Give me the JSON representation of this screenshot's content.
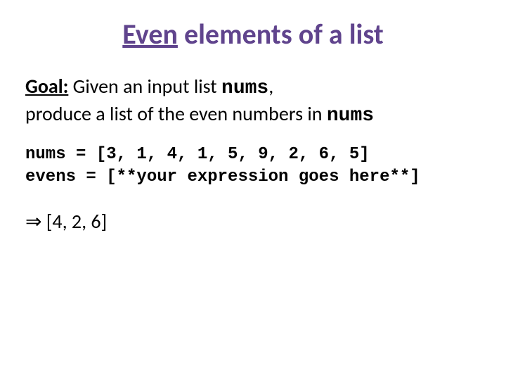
{
  "title": {
    "underlined": "Even",
    "rest": " elements of a list"
  },
  "goal": {
    "label": "Goal:",
    "part1": "  Given an input list ",
    "code1": "nums",
    "part2": ",",
    "part3": "produce a list of the even numbers in ",
    "code2": "nums"
  },
  "code": {
    "line1": "nums = [3, 1, 4, 1, 5, 9, 2, 6, 5]",
    "line2": "evens = [**your expression goes here**]"
  },
  "result": {
    "arrow": "⇒",
    "value": " [4, 2, 6]"
  }
}
